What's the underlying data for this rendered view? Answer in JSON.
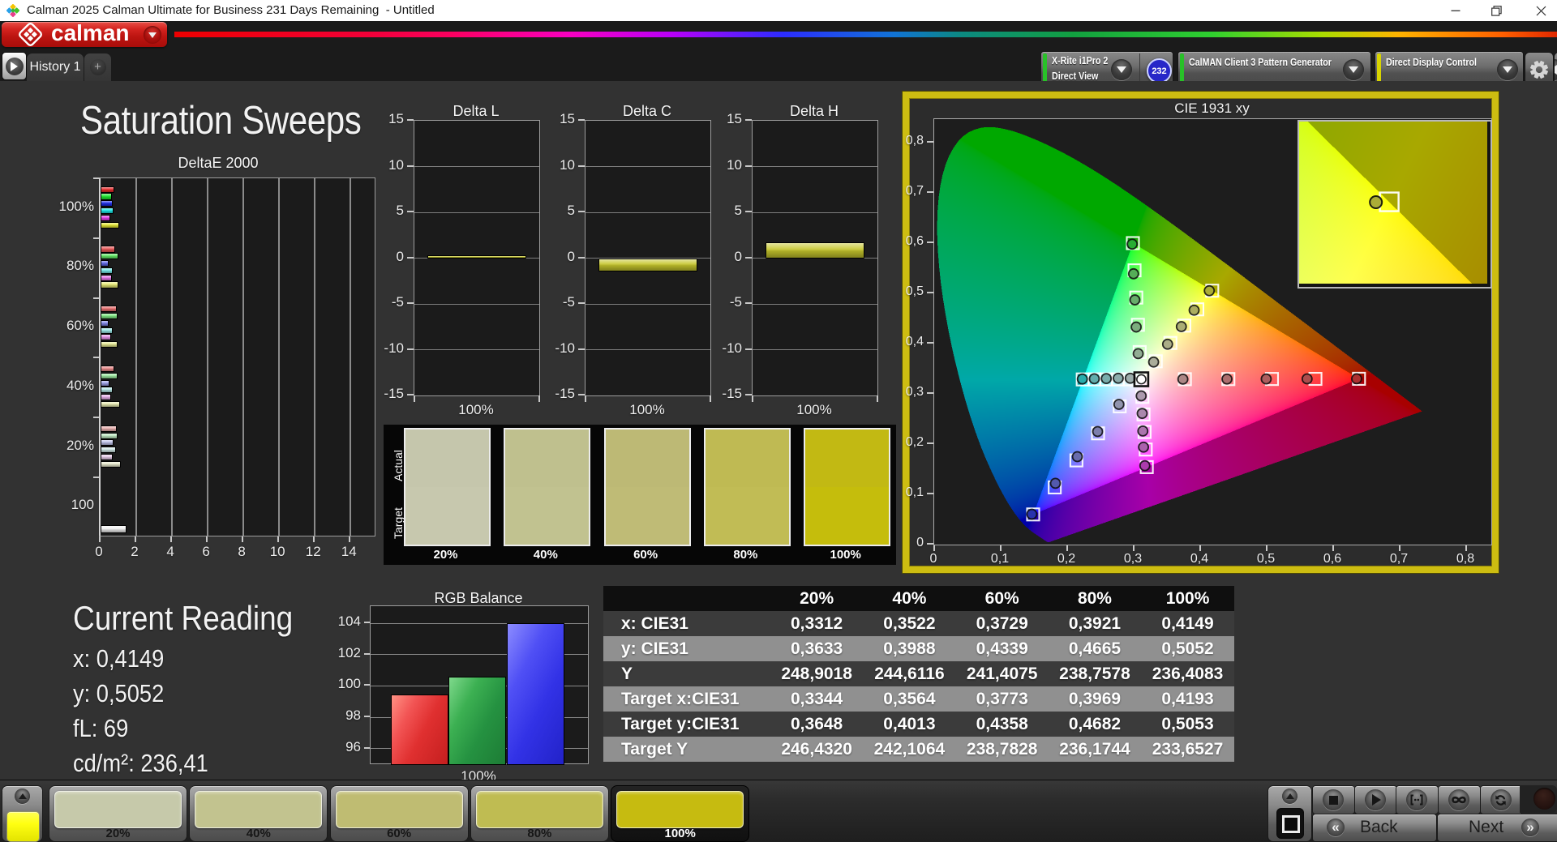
{
  "title_bar": {
    "title": "Calman 2025 Calman Ultimate for Business 231 Days Remaining  - Untitled",
    "window_buttons": [
      "minimize",
      "restore",
      "close"
    ]
  },
  "menu": {
    "logo_word": "calman"
  },
  "tabs": {
    "active_tab": "History 1",
    "add_tab": "+"
  },
  "toolbar": {
    "meter": {
      "line1": "X-Rite i1Pro 2",
      "line2": "Direct View",
      "badge": "232",
      "indicator_color": "#28c128"
    },
    "pattern_source": {
      "label": "CalMAN Client 3 Pattern Generator",
      "indicator_color": "#28c128"
    },
    "display_control": {
      "label": "Direct Display Control",
      "indicator_color": "#d8d400"
    }
  },
  "page": {
    "title": "Saturation Sweeps"
  },
  "chart_data": [
    {
      "id": "deltae2000",
      "type": "bar",
      "title": "DeltaE 2000",
      "orientation": "horizontal",
      "xlim": [
        0,
        15.35
      ],
      "xticks": [
        0,
        2,
        4,
        6,
        8,
        10,
        12,
        14
      ],
      "categories": [
        "100%",
        "80%",
        "60%",
        "40%",
        "20%",
        "100"
      ],
      "series_order": [
        "red",
        "green",
        "blue",
        "cyan",
        "magenta",
        "yellow",
        "white"
      ],
      "groups": [
        {
          "label": "100%",
          "values": [
            0.67,
            0.55,
            0.57,
            0.65,
            0.47,
            0.93,
            null
          ]
        },
        {
          "label": "80%",
          "values": [
            0.74,
            0.91,
            0.37,
            0.61,
            0.54,
            0.9,
            null
          ]
        },
        {
          "label": "60%",
          "values": [
            0.82,
            0.88,
            0.37,
            0.59,
            0.5,
            0.88,
            null
          ]
        },
        {
          "label": "40%",
          "values": [
            0.67,
            0.86,
            0.39,
            0.59,
            0.51,
            1.0,
            null
          ]
        },
        {
          "label": "20%",
          "values": [
            0.8,
            0.86,
            0.65,
            0.78,
            0.57,
            1.06,
            null
          ]
        },
        {
          "label": "100",
          "values": [
            null,
            null,
            null,
            null,
            null,
            null,
            1.36
          ]
        }
      ]
    },
    {
      "id": "delta_l",
      "type": "bar",
      "title": "Delta L",
      "ylim": [
        -15,
        15
      ],
      "yticks": [
        15,
        10,
        5,
        0,
        -5,
        -10,
        -15
      ],
      "categories": [
        "100%"
      ],
      "values": [
        0.25
      ],
      "bar_color": "#c6c62c"
    },
    {
      "id": "delta_c",
      "type": "bar",
      "title": "Delta C",
      "ylim": [
        -15,
        15
      ],
      "yticks": [
        15,
        10,
        5,
        0,
        -5,
        -10,
        -15
      ],
      "categories": [
        "100%"
      ],
      "values": [
        -1.3
      ],
      "bar_color": "#c6c62c"
    },
    {
      "id": "delta_h",
      "type": "bar",
      "title": "Delta H",
      "ylim": [
        -15,
        15
      ],
      "yticks": [
        15,
        10,
        5,
        0,
        -5,
        -10,
        -15
      ],
      "categories": [
        "100%"
      ],
      "values": [
        1.6
      ],
      "bar_color": "#c6c62c"
    },
    {
      "id": "rgb_balance",
      "type": "bar",
      "title": "RGB Balance",
      "ylim": [
        95.05,
        105.1
      ],
      "yticks": [
        104,
        102,
        100,
        98,
        96
      ],
      "categories": [
        "100%"
      ],
      "series": [
        {
          "name": "red",
          "value": 99.45,
          "color": "#e23d3d"
        },
        {
          "name": "green",
          "value": 100.6,
          "color": "#2ea440"
        },
        {
          "name": "blue",
          "value": 104.0,
          "color": "#3434e8"
        }
      ]
    },
    {
      "id": "cie1931",
      "type": "scatter",
      "title": "CIE 1931 xy",
      "xlim": [
        0,
        0.839
      ],
      "ylim": [
        0,
        0.847
      ],
      "xticks": [
        "0",
        "0,1",
        "0,2",
        "0,3",
        "0,4",
        "0,5",
        "0,6",
        "0,7",
        "0,8"
      ],
      "yticks": [
        "0",
        "0,1",
        "0,2",
        "0,3",
        "0,4",
        "0,5",
        "0,6",
        "0,7",
        "0,8"
      ],
      "white_point": [
        0.3127,
        0.329
      ],
      "gamut_triangle": [
        [
          0.64,
          0.33
        ],
        [
          0.3,
          0.6
        ],
        [
          0.15,
          0.06
        ]
      ],
      "sweeps": {
        "red": {
          "targets": [
            [
              0.3782,
              0.3292
            ],
            [
              0.4436,
              0.3294
            ],
            [
              0.5091,
              0.3296
            ],
            [
              0.5745,
              0.3298
            ],
            [
              0.64,
              0.33
            ]
          ],
          "measured": [
            [
              0.3752,
              0.3292
            ],
            [
              0.4415,
              0.3294
            ],
            [
              0.5005,
              0.3296
            ],
            [
              0.562,
              0.3298
            ],
            [
              0.6365,
              0.33
            ]
          ]
        },
        "green": {
          "targets": [
            [
              0.3102,
              0.3832
            ],
            [
              0.3076,
              0.4374
            ],
            [
              0.3051,
              0.4916
            ],
            [
              0.3025,
              0.5458
            ],
            [
              0.3,
              0.6
            ]
          ],
          "measured": [
            [
              0.308,
              0.38
            ],
            [
              0.305,
              0.433
            ],
            [
              0.303,
              0.487
            ],
            [
              0.301,
              0.539
            ],
            [
              0.299,
              0.598
            ]
          ]
        },
        "blue": {
          "targets": [
            [
              0.2802,
              0.2752
            ],
            [
              0.2476,
              0.2214
            ],
            [
              0.2151,
              0.1676
            ],
            [
              0.1825,
              0.1138
            ],
            [
              0.15,
              0.06
            ]
          ],
          "measured": [
            [
              0.279,
              0.279
            ],
            [
              0.247,
              0.225
            ],
            [
              0.2165,
              0.175
            ],
            [
              0.1835,
              0.122
            ],
            [
              0.148,
              0.0605
            ]
          ]
        },
        "cyan": {
          "targets": [
            [
              0.2951,
              0.3289
            ],
            [
              0.2775,
              0.3289
            ],
            [
              0.2598,
              0.3288
            ],
            [
              0.2422,
              0.3288
            ],
            [
              0.2246,
              0.3287
            ]
          ],
          "measured": [
            [
              0.296,
              0.331
            ],
            [
              0.278,
              0.331
            ],
            [
              0.26,
              0.3305
            ],
            [
              0.242,
              0.33
            ],
            [
              0.224,
              0.3295
            ]
          ]
        },
        "magenta": {
          "targets": [
            [
              0.3143,
              0.294
            ],
            [
              0.316,
              0.2591
            ],
            [
              0.3176,
              0.2241
            ],
            [
              0.3193,
              0.1892
            ],
            [
              0.3209,
              0.1542
            ]
          ],
          "measured": [
            [
              0.3125,
              0.296
            ],
            [
              0.314,
              0.261
            ],
            [
              0.315,
              0.226
            ],
            [
              0.316,
              0.194
            ],
            [
              0.318,
              0.157
            ]
          ]
        },
        "yellow": {
          "targets": [
            [
              0.3344,
              0.3648
            ],
            [
              0.3564,
              0.4013
            ],
            [
              0.3773,
              0.4358
            ],
            [
              0.3969,
              0.4682
            ],
            [
              0.4193,
              0.5053
            ]
          ],
          "measured": [
            [
              0.3312,
              0.3633
            ],
            [
              0.3522,
              0.3988
            ],
            [
              0.3729,
              0.4339
            ],
            [
              0.3921,
              0.4665
            ],
            [
              0.4149,
              0.5052
            ]
          ]
        }
      },
      "inset": {
        "xrange": [
          0.3896,
          0.4516
        ],
        "yrange": [
          0.4836,
          0.5266
        ],
        "measured": [
          0.4149,
          0.5052
        ],
        "target": [
          0.4193,
          0.5053
        ]
      }
    }
  ],
  "swatch_strip": {
    "row_labels": [
      "Actual",
      "Target"
    ],
    "columns": [
      {
        "label": "20%",
        "actual": "#c5c6ac",
        "target": "#c7c8ae"
      },
      {
        "label": "40%",
        "actual": "#bfc08e",
        "target": "#c1c290"
      },
      {
        "label": "60%",
        "actual": "#bdb975",
        "target": "#bfbb76"
      },
      {
        "label": "80%",
        "actual": "#bfba53",
        "target": "#c1bc55"
      },
      {
        "label": "100%",
        "actual": "#c2b913",
        "target": "#c5bd0c"
      }
    ]
  },
  "current_reading": {
    "heading": "Current Reading",
    "lines": [
      "x: 0,4149",
      "y: 0,5052",
      "fL: 69",
      "cd/m²: 236,41"
    ]
  },
  "table": {
    "header": [
      "",
      "20%",
      "40%",
      "60%",
      "80%",
      "100%"
    ],
    "rows": [
      {
        "label": "x: CIE31",
        "values": [
          "0,3312",
          "0,3522",
          "0,3729",
          "0,3921",
          "0,4149"
        ]
      },
      {
        "label": "y: CIE31",
        "values": [
          "0,3633",
          "0,3988",
          "0,4339",
          "0,4665",
          "0,5052"
        ]
      },
      {
        "label": "Y",
        "values": [
          "248,9018",
          "244,6116",
          "241,4075",
          "238,7578",
          "236,4083"
        ]
      },
      {
        "label": "Target x:CIE31",
        "values": [
          "0,3344",
          "0,3564",
          "0,3773",
          "0,3969",
          "0,4193"
        ]
      },
      {
        "label": "Target y:CIE31",
        "values": [
          "0,3648",
          "0,4013",
          "0,4358",
          "0,4682",
          "0,5053"
        ]
      },
      {
        "label": "Target Y",
        "values": [
          "246,4320",
          "242,1064",
          "238,7828",
          "236,1744",
          "233,6527"
        ]
      }
    ]
  },
  "bottom_bar": {
    "current_color": "#ffff12",
    "swatches": [
      {
        "label": "20%",
        "color": "#c6c9aa",
        "selected": false
      },
      {
        "label": "40%",
        "color": "#c2c38f",
        "selected": false
      },
      {
        "label": "60%",
        "color": "#bfbc72",
        "selected": false
      },
      {
        "label": "80%",
        "color": "#bfbc52",
        "selected": false
      },
      {
        "label": "100%",
        "color": "#c6bb10",
        "selected": true
      }
    ],
    "transport": [
      "stop",
      "play",
      "measure",
      "continuous",
      "refresh"
    ],
    "back_label": "Back",
    "next_label": "Next"
  }
}
